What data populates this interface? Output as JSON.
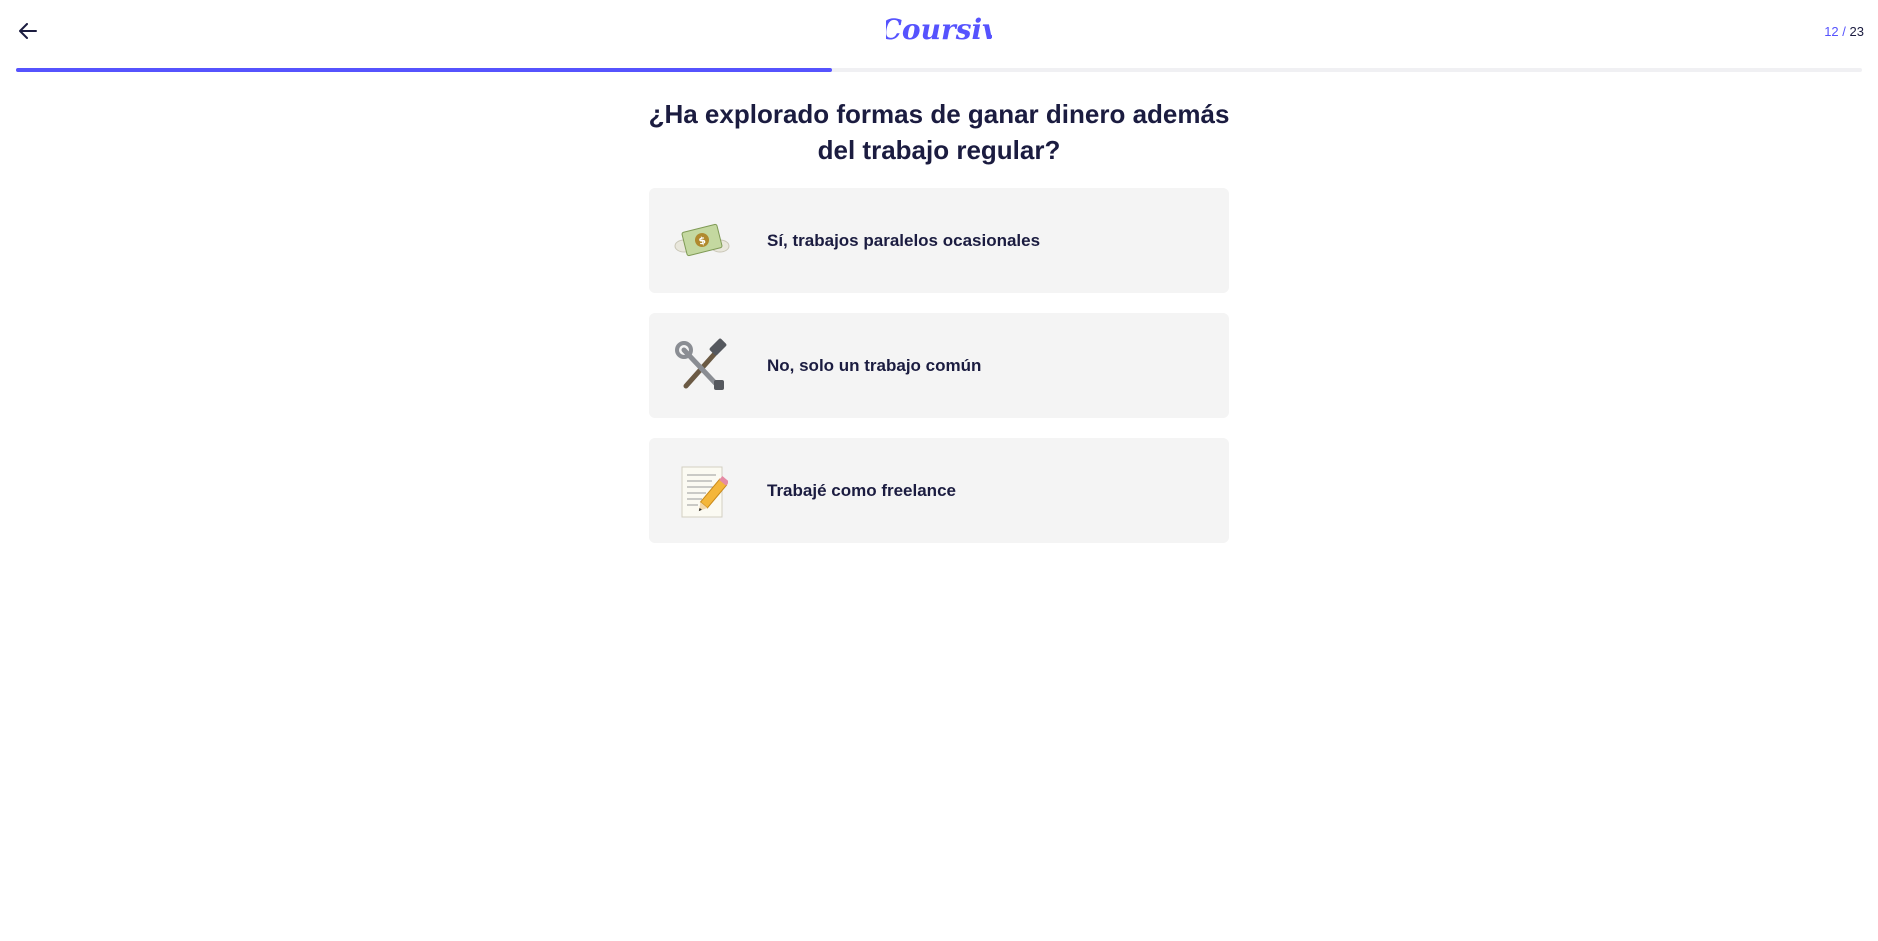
{
  "header": {
    "back_icon": "arrow-left-icon",
    "logo_text": "Coursiv",
    "progress": {
      "current": "12",
      "separator": "/",
      "total": "23",
      "fraction": 0.442
    }
  },
  "question": {
    "title": "¿Ha explorado formas de ganar dinero además del trabajo regular?"
  },
  "options": [
    {
      "label": "Sí, trabajos paralelos ocasionales",
      "icon": "money-with-wings-icon"
    },
    {
      "label": "No, solo un trabajo común",
      "icon": "hammer-and-wrench-icon"
    },
    {
      "label": "Trabajé como freelance",
      "icon": "memo-pencil-icon"
    }
  ],
  "colors": {
    "accent": "#5653fe",
    "text": "#1b1c40",
    "option_bg": "#f4f4f4",
    "track": "#f0f0f3"
  }
}
